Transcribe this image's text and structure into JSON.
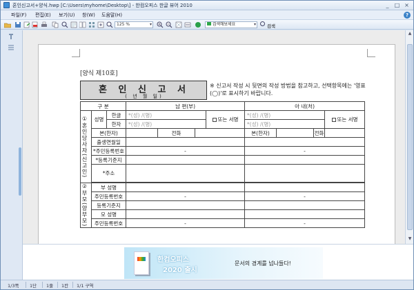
{
  "window": {
    "title": "혼인신고서+양식.hwp [C:\\Users\\myhome\\Desktop\\] - 한컴오피스 한글 뷰어 2010",
    "controls": [
      "_",
      "□",
      "×"
    ]
  },
  "menu": {
    "items": [
      "파일(F)",
      "편집(E)",
      "보기(U)",
      "창(W)",
      "도움말(H)"
    ]
  },
  "toolbar": {
    "zoom_value": "125 %",
    "search_placeholder": "검색해보세요",
    "search_label": "검색"
  },
  "form": {
    "form_no": "[양식 제10호]",
    "title": "혼 인 신 고 서",
    "date_line": "(      년      월      일)",
    "note": "※ 신고서 작성 시 뒷면의 작성 방법을 참고하고, 선택항목에는 '영표(◯)'로 표시하기 바랍니다.",
    "header": {
      "col1": "구  분",
      "husband": "남      편(부)",
      "wife": "아      내(처)"
    },
    "section1": "①혼인당사자(신고인)",
    "section2": "②부모(양부모)",
    "rows": {
      "name": "성명",
      "hangul": "한글",
      "hanja": "한자",
      "surname_hint": "*(성)",
      "given_hint": "/(명)",
      "sign_or": "또는 서명",
      "origin": "본(한자)",
      "phone": "전화",
      "birth": "출생연월일",
      "resident_no": "*주민등록번호",
      "registry": "*등록기준지",
      "address": "*주소",
      "father_name": "부 성명",
      "resident_no2": "주민등록번호",
      "registry2": "등록기준지",
      "mother_name": "모 성명",
      "resident_no3": "주민등록번호",
      "dash": "-"
    }
  },
  "ad": {
    "line1": "한컴오피스",
    "line2": "2020 출시",
    "slogan": "문서의 경계를 넘나들다!"
  },
  "status": {
    "page": "1/3쪽",
    "section": "1단",
    "line": "1줄",
    "col": "1칸",
    "area": "1/1 구역"
  }
}
